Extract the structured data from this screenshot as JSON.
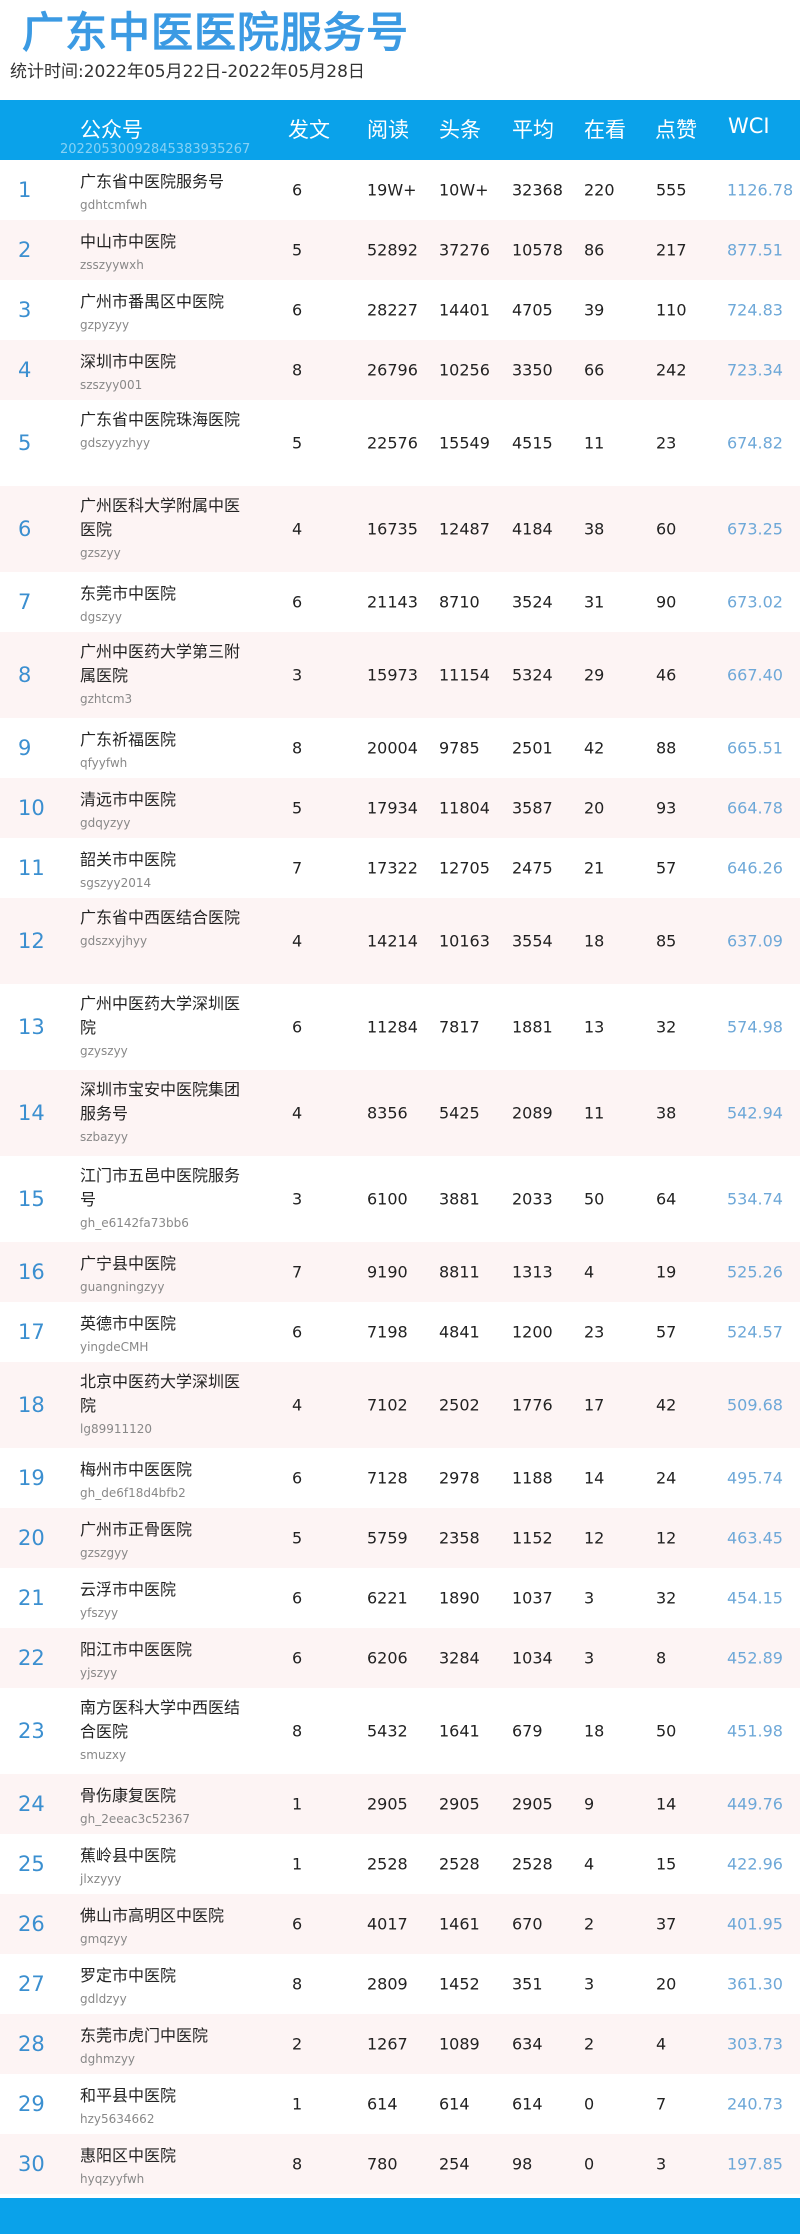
{
  "title": "广东中医医院服务号",
  "period": "统计时间:2022年05月22日-2022年05月28日",
  "watermark": "20220530092845383935267",
  "headers": {
    "account": "公众号",
    "posts": "发文",
    "reads": "阅读",
    "headline": "头条",
    "avg": "平均",
    "watching": "在看",
    "likes": "点赞",
    "wci": "WCI"
  },
  "rows": [
    {
      "rank": "1",
      "name": "广东省中医院服务号",
      "id": "gdhtcmfwh",
      "posts": "6",
      "reads": "19W+",
      "headline": "10W+",
      "avg": "32368",
      "watching": "220",
      "likes": "555",
      "wci": "1126.78"
    },
    {
      "rank": "2",
      "name": "中山市中医院",
      "id": "zsszyywxh",
      "posts": "5",
      "reads": "52892",
      "headline": "37276",
      "avg": "10578",
      "watching": "86",
      "likes": "217",
      "wci": "877.51"
    },
    {
      "rank": "3",
      "name": "广州市番禺区中医院",
      "id": "gzpyzyy",
      "posts": "6",
      "reads": "28227",
      "headline": "14401",
      "avg": "4705",
      "watching": "39",
      "likes": "110",
      "wci": "724.83"
    },
    {
      "rank": "4",
      "name": "深圳市中医院",
      "id": "szszyy001",
      "posts": "8",
      "reads": "26796",
      "headline": "10256",
      "avg": "3350",
      "watching": "66",
      "likes": "242",
      "wci": "723.34"
    },
    {
      "rank": "5",
      "name": "广东省中医院珠海医院",
      "id": "gdszyyzhyy",
      "posts": "5",
      "reads": "22576",
      "headline": "15549",
      "avg": "4515",
      "watching": "11",
      "likes": "23",
      "wci": "674.82"
    },
    {
      "rank": "6",
      "name": "广州医科大学附属中医医院",
      "id": "gzszyy",
      "posts": "4",
      "reads": "16735",
      "headline": "12487",
      "avg": "4184",
      "watching": "38",
      "likes": "60",
      "wci": "673.25"
    },
    {
      "rank": "7",
      "name": "东莞市中医院",
      "id": "dgszyy",
      "posts": "6",
      "reads": "21143",
      "headline": "8710",
      "avg": "3524",
      "watching": "31",
      "likes": "90",
      "wci": "673.02"
    },
    {
      "rank": "8",
      "name": "广州中医药大学第三附属医院",
      "id": "gzhtcm3",
      "posts": "3",
      "reads": "15973",
      "headline": "11154",
      "avg": "5324",
      "watching": "29",
      "likes": "46",
      "wci": "667.40"
    },
    {
      "rank": "9",
      "name": "广东祈福医院",
      "id": "qfyyfwh",
      "posts": "8",
      "reads": "20004",
      "headline": "9785",
      "avg": "2501",
      "watching": "42",
      "likes": "88",
      "wci": "665.51"
    },
    {
      "rank": "10",
      "name": "清远市中医院",
      "id": "gdqyzyy",
      "posts": "5",
      "reads": "17934",
      "headline": "11804",
      "avg": "3587",
      "watching": "20",
      "likes": "93",
      "wci": "664.78"
    },
    {
      "rank": "11",
      "name": "韶关市中医院",
      "id": "sgszyy2014",
      "posts": "7",
      "reads": "17322",
      "headline": "12705",
      "avg": "2475",
      "watching": "21",
      "likes": "57",
      "wci": "646.26"
    },
    {
      "rank": "12",
      "name": "广东省中西医结合医院",
      "id": "gdszxyjhyy",
      "posts": "4",
      "reads": "14214",
      "headline": "10163",
      "avg": "3554",
      "watching": "18",
      "likes": "85",
      "wci": "637.09"
    },
    {
      "rank": "13",
      "name": "广州中医药大学深圳医院",
      "id": "gzyszyy",
      "posts": "6",
      "reads": "11284",
      "headline": "7817",
      "avg": "1881",
      "watching": "13",
      "likes": "32",
      "wci": "574.98"
    },
    {
      "rank": "14",
      "name": "深圳市宝安中医院集团服务号",
      "id": "szbazyy",
      "posts": "4",
      "reads": "8356",
      "headline": "5425",
      "avg": "2089",
      "watching": "11",
      "likes": "38",
      "wci": "542.94"
    },
    {
      "rank": "15",
      "name": "江门市五邑中医院服务号",
      "id": "gh_e6142fa73bb6",
      "posts": "3",
      "reads": "6100",
      "headline": "3881",
      "avg": "2033",
      "watching": "50",
      "likes": "64",
      "wci": "534.74"
    },
    {
      "rank": "16",
      "name": "广宁县中医院",
      "id": "guangningzyy",
      "posts": "7",
      "reads": "9190",
      "headline": "8811",
      "avg": "1313",
      "watching": "4",
      "likes": "19",
      "wci": "525.26"
    },
    {
      "rank": "17",
      "name": "英德市中医院",
      "id": "yingdeCMH",
      "posts": "6",
      "reads": "7198",
      "headline": "4841",
      "avg": "1200",
      "watching": "23",
      "likes": "57",
      "wci": "524.57"
    },
    {
      "rank": "18",
      "name": "北京中医药大学深圳医院",
      "id": "lg89911120",
      "posts": "4",
      "reads": "7102",
      "headline": "2502",
      "avg": "1776",
      "watching": "17",
      "likes": "42",
      "wci": "509.68"
    },
    {
      "rank": "19",
      "name": "梅州市中医医院",
      "id": "gh_de6f18d4bfb2",
      "posts": "6",
      "reads": "7128",
      "headline": "2978",
      "avg": "1188",
      "watching": "14",
      "likes": "24",
      "wci": "495.74"
    },
    {
      "rank": "20",
      "name": "广州市正骨医院",
      "id": "gzszgyy",
      "posts": "5",
      "reads": "5759",
      "headline": "2358",
      "avg": "1152",
      "watching": "12",
      "likes": "12",
      "wci": "463.45"
    },
    {
      "rank": "21",
      "name": "云浮市中医院",
      "id": "yfszyy",
      "posts": "6",
      "reads": "6221",
      "headline": "1890",
      "avg": "1037",
      "watching": "3",
      "likes": "32",
      "wci": "454.15"
    },
    {
      "rank": "22",
      "name": "阳江市中医医院",
      "id": "yjszyy",
      "posts": "6",
      "reads": "6206",
      "headline": "3284",
      "avg": "1034",
      "watching": "3",
      "likes": "8",
      "wci": "452.89"
    },
    {
      "rank": "23",
      "name": "南方医科大学中西医结合医院",
      "id": "smuzxy",
      "posts": "8",
      "reads": "5432",
      "headline": "1641",
      "avg": "679",
      "watching": "18",
      "likes": "50",
      "wci": "451.98"
    },
    {
      "rank": "24",
      "name": "骨伤康复医院",
      "id": "gh_2eeac3c52367",
      "posts": "1",
      "reads": "2905",
      "headline": "2905",
      "avg": "2905",
      "watching": "9",
      "likes": "14",
      "wci": "449.76"
    },
    {
      "rank": "25",
      "name": "蕉岭县中医院",
      "id": "jlxzyyy",
      "posts": "1",
      "reads": "2528",
      "headline": "2528",
      "avg": "2528",
      "watching": "4",
      "likes": "15",
      "wci": "422.96"
    },
    {
      "rank": "26",
      "name": "佛山市高明区中医院",
      "id": "gmqzyy",
      "posts": "6",
      "reads": "4017",
      "headline": "1461",
      "avg": "670",
      "watching": "2",
      "likes": "37",
      "wci": "401.95"
    },
    {
      "rank": "27",
      "name": "罗定市中医院",
      "id": "gdldzyy",
      "posts": "8",
      "reads": "2809",
      "headline": "1452",
      "avg": "351",
      "watching": "3",
      "likes": "20",
      "wci": "361.30"
    },
    {
      "rank": "28",
      "name": "东莞市虎门中医院",
      "id": "dghmzyy",
      "posts": "2",
      "reads": "1267",
      "headline": "1089",
      "avg": "634",
      "watching": "2",
      "likes": "4",
      "wci": "303.73"
    },
    {
      "rank": "29",
      "name": "和平县中医院",
      "id": "hzy5634662",
      "posts": "1",
      "reads": "614",
      "headline": "614",
      "avg": "614",
      "watching": "0",
      "likes": "7",
      "wci": "240.73"
    },
    {
      "rank": "30",
      "name": "惠阳区中医院",
      "id": "hyqzyyfwh",
      "posts": "8",
      "reads": "780",
      "headline": "254",
      "avg": "98",
      "watching": "0",
      "likes": "3",
      "wci": "197.85"
    }
  ]
}
